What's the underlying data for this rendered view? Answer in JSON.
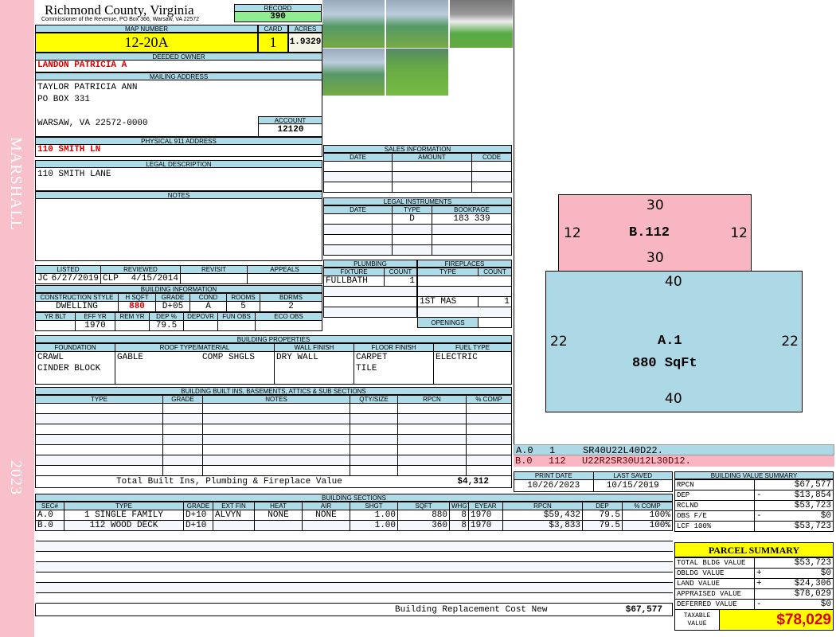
{
  "sidebar": {
    "district": "MARSHALL",
    "year": "2023"
  },
  "header": {
    "county": "Richmond County, Virginia",
    "subtitle": "Commissioner of the Revenue, PO Box 366, Warsaw, VA 22572",
    "record_label": "RECORD",
    "record": "390"
  },
  "parcel": {
    "map_label": "MAP NUMBER",
    "map": "12-20A",
    "card_label": "CARD",
    "card": "1",
    "acres_label": "ACRES",
    "acres": "1.9329"
  },
  "owner": {
    "label": "DEEDED OWNER",
    "name": "LANDON PATRICIA A"
  },
  "mailing": {
    "label": "MAILING ADDRESS",
    "line1": "TAYLOR PATRICIA ANN",
    "line2": "PO BOX 331",
    "line3": "WARSAW, VA 22572-0000",
    "account_label": "ACCOUNT",
    "account": "12120"
  },
  "physical": {
    "label": "PHYSICAL 911 ADDRESS",
    "value": "110 SMITH LN"
  },
  "legal": {
    "label": "LEGAL DESCRIPTION",
    "value": "110 SMITH LANE"
  },
  "notes": {
    "label": "NOTES"
  },
  "listing": {
    "headers": [
      "LISTED",
      "REVIEWED",
      "REVISIT",
      "APPEALS"
    ],
    "listed_by": "JC",
    "listed": "6/27/2019",
    "reviewed_by": "CLP",
    "reviewed": "4/15/2014"
  },
  "building_info": {
    "label": "BUILDING INFORMATION",
    "h1": [
      "CONSTRUCTION STYLE",
      "H SQFT",
      "GRADE",
      "COND",
      "ROOMS",
      "BDRMS"
    ],
    "v1": [
      "DWELLING",
      "880",
      "D+05",
      "A",
      "5",
      "2"
    ],
    "h2": [
      "YR BLT",
      "EFF YR",
      "REM YR",
      "DEP %",
      "DEPOVR",
      "FUN OBS",
      "ECO OBS"
    ],
    "v2": [
      "",
      "1970",
      "",
      "79.5",
      "",
      "",
      ""
    ]
  },
  "sales": {
    "label": "SALES INFORMATION",
    "headers": [
      "DATE",
      "AMOUNT",
      "CODE"
    ]
  },
  "legal_instruments": {
    "label": "LEGAL INSTRUMENTS",
    "headers": [
      "DATE",
      "TYPE",
      "BOOKPAGE"
    ],
    "rows": [
      [
        "",
        "D",
        "183 339"
      ]
    ]
  },
  "plumbing": {
    "label": "PLUMBING",
    "headers": [
      "FIXTURE",
      "COUNT"
    ],
    "rows": [
      [
        "FULLBATH",
        "1"
      ]
    ]
  },
  "fireplaces": {
    "label": "FIREPLACES",
    "headers": [
      "TYPE",
      "COUNT"
    ],
    "rows": [
      [
        "1ST MAS",
        "1"
      ]
    ],
    "openings": "OPENINGS"
  },
  "properties": {
    "label": "BUILDING PROPERTIES",
    "headers": [
      "FOUNDATION",
      "ROOF TYPE/MATERIAL",
      "WALL FINISH",
      "FLOOR FINISH",
      "FUEL TYPE"
    ],
    "foundation": [
      "CRAWL",
      "CINDER BLOCK"
    ],
    "roof_type": "GABLE",
    "roof_material": "COMP SHGLS",
    "wall": "DRY WALL",
    "floor": [
      "CARPET",
      "TILE"
    ],
    "fuel": "ELECTRIC"
  },
  "builtins": {
    "label": "BUILDING BUILT INS, BASEMENTS, ATTICS & SUB SECTIONS",
    "headers": [
      "TYPE",
      "GRADE",
      "NOTES",
      "QTY/SIZE",
      "RPCN",
      "% COMP"
    ],
    "total_label": "Total Built Ins, Plumbing & Fireplace Value",
    "total": "$4,312"
  },
  "dates": {
    "print_label": "PRINT DATE",
    "print": "10/26/2023",
    "saved_label": "LAST SAVED",
    "saved": "10/15/2019"
  },
  "sections": {
    "label": "BUILDING SECTIONS",
    "headers": [
      "SEC#",
      "TYPE",
      "GRADE",
      "EXT FIN",
      "HEAT",
      "AIR",
      "SHGT",
      "SQFT",
      "WHGT",
      "EYEAR",
      "RPCN",
      "DEP",
      "% COMP"
    ],
    "rows": [
      [
        "A.0",
        "1 SINGLE FAMILY",
        "D+10",
        "ALVYN",
        "NONE",
        "NONE",
        "1.00",
        "880",
        "8",
        "1970",
        "$59,432",
        "79.5",
        "100%"
      ],
      [
        "B.0",
        "112 WOOD DECK",
        "D+10",
        "",
        "",
        "",
        "1.00",
        "360",
        "8",
        "1970",
        "$3,833",
        "79.5",
        "100%"
      ]
    ],
    "total_label": "Building Replacement Cost New",
    "total": "$67,577"
  },
  "sketch": {
    "b": {
      "label": "B.112",
      "top": "30",
      "bottom": "30",
      "left": "12",
      "right": "12"
    },
    "a": {
      "label": "A.1",
      "area": "880 SqFt",
      "top": "40",
      "bottom": "40",
      "left": "22",
      "right": "22"
    },
    "lines": [
      {
        "sec": "A.0",
        "code": "1",
        "path": "SR40U22L40D22."
      },
      {
        "sec": "B.0",
        "code": "112",
        "path": "U22R2SR30U12L30D12."
      }
    ],
    "colors": {
      "a": "#add8e6",
      "b": "#f7b6c2"
    }
  },
  "value_summary": {
    "label": "BUILDING VALUE SUMMARY",
    "rows": [
      [
        "RPCN",
        "",
        "$67,577"
      ],
      [
        "DEP",
        "-",
        "$13,854"
      ],
      [
        "RCLND",
        "",
        "$53,723"
      ],
      [
        "OBS F/E",
        "-",
        "$0"
      ],
      [
        "LCF 100%",
        "",
        "$53,723"
      ]
    ]
  },
  "parcel_summary": {
    "label": "PARCEL SUMMARY",
    "rows": [
      [
        "TOTAL BLDG VALUE",
        "",
        "$53,723"
      ],
      [
        "OBLDG VALUE",
        "+",
        "$0"
      ],
      [
        "LAND VALUE",
        "+",
        "$24,306"
      ],
      [
        "APPRAISED VALUE",
        "",
        "$78,029"
      ],
      [
        "DEFERRED VALUE",
        "-",
        "$0"
      ]
    ],
    "taxable_label": "TAXABLE VALUE",
    "taxable": "$78,029"
  }
}
